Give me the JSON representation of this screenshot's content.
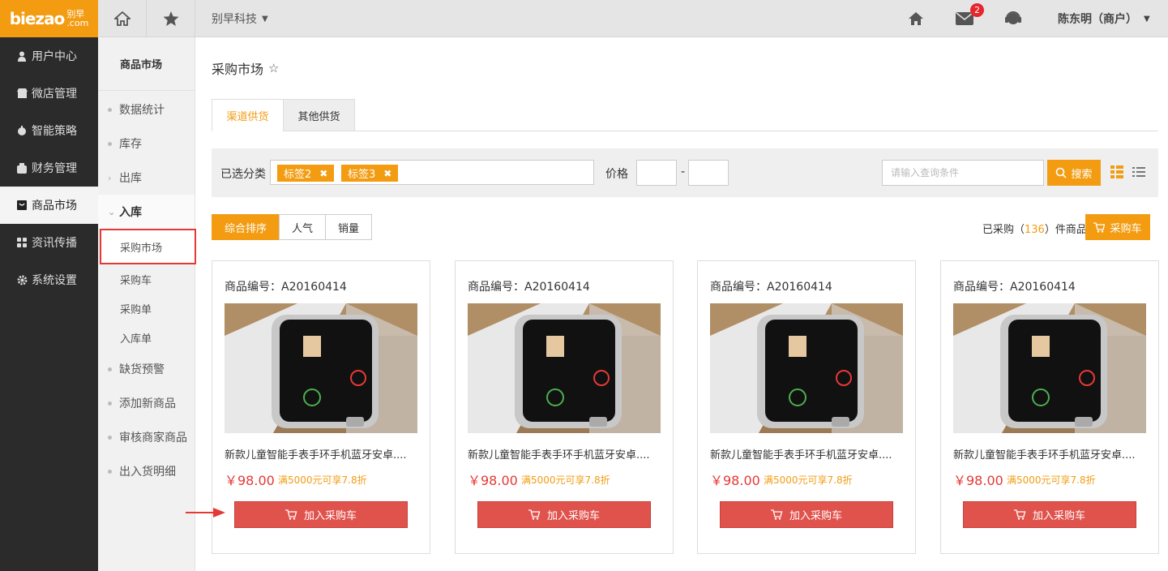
{
  "topbar": {
    "logo_text": "biezao",
    "logo_cn_top": "别早",
    "logo_cn_bottom": ".com",
    "company": "别早科技",
    "mail_count": "2",
    "user": "陈东明（商户）"
  },
  "sidebar": {
    "items": [
      {
        "label": "用户中心",
        "icon": "user-icon"
      },
      {
        "label": "微店管理",
        "icon": "shop-icon"
      },
      {
        "label": "智能策略",
        "icon": "strategy-icon"
      },
      {
        "label": "财务管理",
        "icon": "wallet-icon"
      },
      {
        "label": "商品市场",
        "icon": "market-icon"
      },
      {
        "label": "资讯传播",
        "icon": "grid-icon"
      },
      {
        "label": "系统设置",
        "icon": "gear-icon"
      }
    ]
  },
  "subnav": {
    "title": "商品市场",
    "items": [
      "数据统计",
      "库存",
      "出库",
      "入库"
    ],
    "children": [
      "采购市场",
      "采购车",
      "采购单",
      "入库单"
    ],
    "items_after": [
      "缺货预警",
      "添加新商品",
      "审核商家商品",
      "出入货明细"
    ]
  },
  "main": {
    "title": "采购市场",
    "tabs": [
      "渠道供货",
      "其他供货"
    ],
    "filter": {
      "category_label": "已选分类",
      "tags": [
        "标签2",
        "标签3"
      ],
      "price_label": "价格",
      "dash": "-",
      "search_placeholder": "请输入查询条件",
      "search_button": "搜索"
    },
    "sort": [
      "综合排序",
      "人气",
      "销量"
    ],
    "bought_prefix": "已采购（",
    "bought_count": "136",
    "bought_suffix": "）件商品",
    "cart_button": "采购车"
  },
  "products": [
    {
      "code": "商品编号：A20160414",
      "name": "新款儿童智能手表手环手机蓝牙安卓....",
      "price": "￥98.00",
      "promo": "满5000元可享7.8折",
      "button": "加入采购车"
    },
    {
      "code": "商品编号：A20160414",
      "name": "新款儿童智能手表手环手机蓝牙安卓....",
      "price": "￥98.00",
      "promo": "满5000元可享7.8折",
      "button": "加入采购车"
    },
    {
      "code": "商品编号：A20160414",
      "name": "新款儿童智能手表手环手机蓝牙安卓....",
      "price": "￥98.00",
      "promo": "满5000元可享7.8折",
      "button": "加入采购车"
    },
    {
      "code": "商品编号：A20160414",
      "name": "新款儿童智能手表手环手机蓝牙安卓....",
      "price": "￥98.00",
      "promo": "满5000元可享7.8折",
      "button": "加入采购车"
    }
  ],
  "colors": {
    "accent": "#f39c12",
    "danger": "#e0534d",
    "sidebar": "#2b2b2b"
  }
}
